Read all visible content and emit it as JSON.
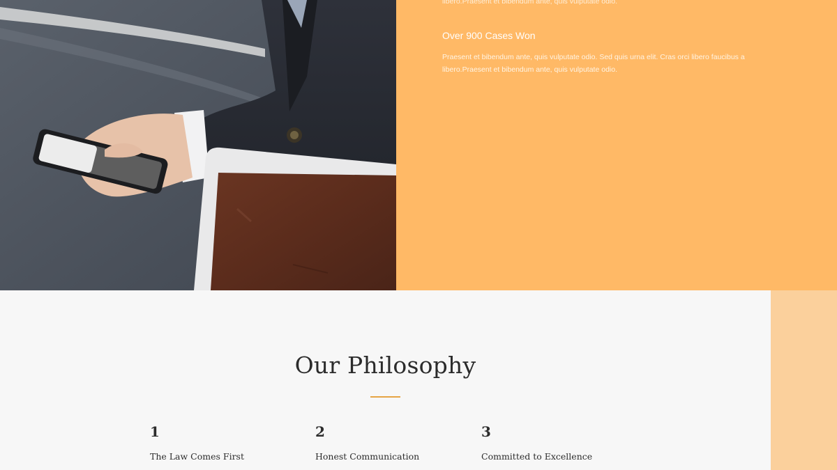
{
  "hero": {
    "cut_text": "libero.Praesent et bibendum ante, quis vulputate odio.",
    "feature": {
      "title": "Over 900 Cases Won",
      "text": "Praesent et bibendum ante, quis vulputate odio. Sed quis urna elit. Cras orci libero faucibus a libero.Praesent et bibendum ante, quis vulputate odio."
    },
    "photo_icon": "businessman-phone-laptop-photo"
  },
  "philosophy": {
    "title": "Our Philosophy",
    "items": [
      {
        "number": "1",
        "title": "The Law Comes First"
      },
      {
        "number": "2",
        "title": "Honest Communication"
      },
      {
        "number": "3",
        "title": "Committed to Excellence"
      }
    ]
  },
  "colors": {
    "accent_orange": "#ffb966",
    "accent_light": "#fbd09c",
    "divider": "#e6a444",
    "background": "#f7f7f7"
  }
}
